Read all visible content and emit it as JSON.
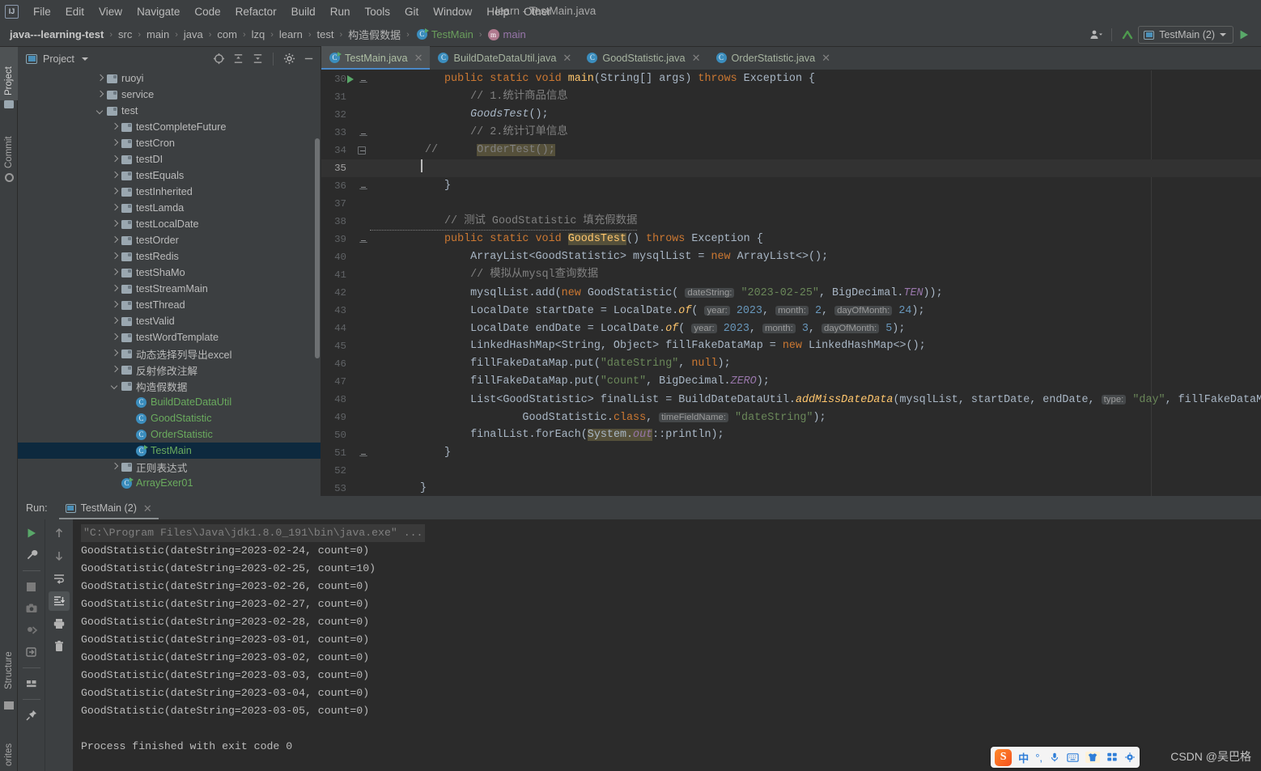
{
  "window": {
    "title": "learn - TestMain.java"
  },
  "menubar": {
    "logo": "ij-logo",
    "items": [
      "File",
      "Edit",
      "View",
      "Navigate",
      "Code",
      "Refactor",
      "Build",
      "Run",
      "Tools",
      "Git",
      "Window",
      "Help",
      "Other"
    ]
  },
  "breadcrumb": {
    "items": [
      {
        "label": "java---learning-test",
        "style": "bold"
      },
      {
        "label": "src",
        "style": "plain"
      },
      {
        "label": "main",
        "style": "plain"
      },
      {
        "label": "java",
        "style": "plain"
      },
      {
        "label": "com",
        "style": "plain"
      },
      {
        "label": "lzq",
        "style": "plain"
      },
      {
        "label": "learn",
        "style": "plain"
      },
      {
        "label": "test",
        "style": "plain"
      },
      {
        "label": "构造假数据",
        "style": "plain"
      },
      {
        "label": "TestMain",
        "style": "green"
      },
      {
        "label": "main",
        "style": "mauve"
      }
    ],
    "separator": "›"
  },
  "toolbar_right": {
    "user_icon": "user-avatar-icon",
    "updates_icon": "update-arrow-icon",
    "run_config": "TestMain (2)",
    "run_button_icon": "run-play-icon"
  },
  "left_strip": {
    "tabs": [
      {
        "label": "Project",
        "icon": "project-icon",
        "active": true
      },
      {
        "label": "Commit",
        "icon": "commit-icon",
        "active": false
      }
    ],
    "bottom_tabs": [
      {
        "label": "Structure",
        "icon": "structure-icon"
      },
      {
        "label": "orites",
        "icon": "favorites-icon"
      }
    ]
  },
  "project_panel": {
    "title": "Project",
    "title_icon": "project-window-icon",
    "dropdown_icon": "chevron-down-icon",
    "tools": [
      "locate-icon",
      "expand-all-icon",
      "collapse-all-icon",
      "gear-icon",
      "minimize-icon"
    ],
    "tree": [
      {
        "label": "ruoyi",
        "type": "folder",
        "indent": 1,
        "state": "collapsed"
      },
      {
        "label": "service",
        "type": "folder",
        "indent": 1,
        "state": "collapsed"
      },
      {
        "label": "test",
        "type": "folder",
        "indent": 1,
        "state": "expanded"
      },
      {
        "label": "testCompleteFuture",
        "type": "folder",
        "indent": 2,
        "state": "collapsed"
      },
      {
        "label": "testCron",
        "type": "folder",
        "indent": 2,
        "state": "collapsed"
      },
      {
        "label": "testDI",
        "type": "folder",
        "indent": 2,
        "state": "collapsed"
      },
      {
        "label": "testEquals",
        "type": "folder",
        "indent": 2,
        "state": "collapsed"
      },
      {
        "label": "testInherited",
        "type": "folder",
        "indent": 2,
        "state": "collapsed"
      },
      {
        "label": "testLamda",
        "type": "folder",
        "indent": 2,
        "state": "collapsed"
      },
      {
        "label": "testLocalDate",
        "type": "folder",
        "indent": 2,
        "state": "collapsed"
      },
      {
        "label": "testOrder",
        "type": "folder",
        "indent": 2,
        "state": "collapsed"
      },
      {
        "label": "testRedis",
        "type": "folder",
        "indent": 2,
        "state": "collapsed"
      },
      {
        "label": "testShaMo",
        "type": "folder",
        "indent": 2,
        "state": "collapsed"
      },
      {
        "label": "testStreamMain",
        "type": "folder",
        "indent": 2,
        "state": "collapsed"
      },
      {
        "label": "testThread",
        "type": "folder",
        "indent": 2,
        "state": "collapsed"
      },
      {
        "label": "testValid",
        "type": "folder",
        "indent": 2,
        "state": "collapsed"
      },
      {
        "label": "testWordTemplate",
        "type": "folder",
        "indent": 2,
        "state": "collapsed"
      },
      {
        "label": "动态选择列导出excel",
        "type": "folder",
        "indent": 2,
        "state": "collapsed"
      },
      {
        "label": "反射修改注解",
        "type": "folder",
        "indent": 2,
        "state": "collapsed"
      },
      {
        "label": "构造假数据",
        "type": "folder",
        "indent": 2,
        "state": "expanded"
      },
      {
        "label": "BuildDateDataUtil",
        "type": "class",
        "indent": 3,
        "state": "leaf"
      },
      {
        "label": "GoodStatistic",
        "type": "class",
        "indent": 3,
        "state": "leaf"
      },
      {
        "label": "OrderStatistic",
        "type": "class",
        "indent": 3,
        "state": "leaf"
      },
      {
        "label": "TestMain",
        "type": "class-runnable",
        "indent": 3,
        "state": "leaf",
        "selected": true
      },
      {
        "label": "正则表达式",
        "type": "folder",
        "indent": 2,
        "state": "collapsed"
      },
      {
        "label": "ArrayExer01",
        "type": "class-runnable",
        "indent": 2,
        "state": "leaf"
      }
    ]
  },
  "editor_tabs": [
    {
      "label": "TestMain.java",
      "icon": "java-class-runnable-icon",
      "active": true,
      "close": "✕"
    },
    {
      "label": "BuildDateDataUtil.java",
      "icon": "java-class-icon",
      "active": false,
      "close": "✕"
    },
    {
      "label": "GoodStatistic.java",
      "icon": "java-class-icon",
      "active": false,
      "close": "✕"
    },
    {
      "label": "OrderStatistic.java",
      "icon": "java-class-icon",
      "active": false,
      "close": "✕"
    }
  ],
  "editor": {
    "first_line": 30,
    "current_line": 35,
    "lines": [
      {
        "n": "30",
        "text": "public static void main(String[] args) throws Exception {"
      },
      {
        "n": "31",
        "text": "    // 1.统计商品信息"
      },
      {
        "n": "32",
        "text": "    GoodsTest();"
      },
      {
        "n": "33",
        "text": "    // 2.统计订单信息"
      },
      {
        "n": "34",
        "text": "//      OrderTest();"
      },
      {
        "n": "35",
        "text": ""
      },
      {
        "n": "36",
        "text": "}"
      },
      {
        "n": "37",
        "text": ""
      },
      {
        "n": "38",
        "text": "// 测试 GoodStatistic 填充假数据"
      },
      {
        "n": "39",
        "text": "public static void GoodsTest() throws Exception {"
      },
      {
        "n": "40",
        "text": "    ArrayList<GoodStatistic> mysqlList = new ArrayList<>();"
      },
      {
        "n": "41",
        "text": "    // 模拟从mysql查询数据"
      },
      {
        "n": "42",
        "text": "    mysqlList.add(new GoodStatistic( dateString: \"2023-02-25\", BigDecimal.TEN));"
      },
      {
        "n": "43",
        "text": "    LocalDate startDate = LocalDate.of( year: 2023, month: 2, dayOfMonth: 24);"
      },
      {
        "n": "44",
        "text": "    LocalDate endDate = LocalDate.of( year: 2023, month: 3, dayOfMonth: 5);"
      },
      {
        "n": "45",
        "text": "    LinkedHashMap<String, Object> fillFakeDataMap = new LinkedHashMap<>();"
      },
      {
        "n": "46",
        "text": "    fillFakeDataMap.put(\"dateString\", null);"
      },
      {
        "n": "47",
        "text": "    fillFakeDataMap.put(\"count\", BigDecimal.ZERO);"
      },
      {
        "n": "48",
        "text": "    List<GoodStatistic> finalList = BuildDateDataUtil.addMissDateData(mysqlList, startDate, endDate,  type: \"day\", fillFakeDataMap,"
      },
      {
        "n": "49",
        "text": "            GoodStatistic.class,  timeFieldName: \"dateString\");"
      },
      {
        "n": "50",
        "text": "    finalList.forEach(System.out::println);"
      },
      {
        "n": "51",
        "text": "}"
      },
      {
        "n": "52",
        "text": ""
      },
      {
        "n": "53",
        "text": "}"
      }
    ]
  },
  "run_panel": {
    "run_label": "Run:",
    "tab_label": "TestMain (2)",
    "tab_close": "✕",
    "tools_left": [
      "rerun-icon",
      "settings-wrench-icon",
      "stop-icon",
      "camera-icon",
      "thread-dump-icon",
      "export-icon",
      "layout-icon",
      "pin-icon"
    ],
    "tools_right": [
      "up-arrow-icon",
      "down-arrow-icon",
      "soft-wrap-icon",
      "scroll-to-end-icon",
      "print-icon",
      "trash-icon"
    ],
    "console": [
      {
        "text": "\"C:\\Program Files\\Java\\jdk1.8.0_191\\bin\\java.exe\" ...",
        "kind": "cmd"
      },
      {
        "text": "GoodStatistic(dateString=2023-02-24, count=0)",
        "kind": "out"
      },
      {
        "text": "GoodStatistic(dateString=2023-02-25, count=10)",
        "kind": "out"
      },
      {
        "text": "GoodStatistic(dateString=2023-02-26, count=0)",
        "kind": "out"
      },
      {
        "text": "GoodStatistic(dateString=2023-02-27, count=0)",
        "kind": "out"
      },
      {
        "text": "GoodStatistic(dateString=2023-02-28, count=0)",
        "kind": "out"
      },
      {
        "text": "GoodStatistic(dateString=2023-03-01, count=0)",
        "kind": "out"
      },
      {
        "text": "GoodStatistic(dateString=2023-03-02, count=0)",
        "kind": "out"
      },
      {
        "text": "GoodStatistic(dateString=2023-03-03, count=0)",
        "kind": "out"
      },
      {
        "text": "GoodStatistic(dateString=2023-03-04, count=0)",
        "kind": "out"
      },
      {
        "text": "GoodStatistic(dateString=2023-03-05, count=0)",
        "kind": "out"
      },
      {
        "text": "",
        "kind": "out"
      },
      {
        "text": "Process finished with exit code 0",
        "kind": "out"
      }
    ]
  },
  "ime_bar": {
    "logo": "sogou-logo",
    "items": [
      {
        "icon": "chinese-mode-icon",
        "glyph": "中"
      },
      {
        "icon": "punctuation-icon",
        "glyph": "°,"
      },
      {
        "icon": "microphone-icon",
        "glyph": "Ἲ4"
      },
      {
        "icon": "keyboard-icon",
        "glyph": "⌨"
      },
      {
        "icon": "skin-icon",
        "glyph": "T"
      },
      {
        "icon": "apps-grid-icon",
        "glyph": "░"
      },
      {
        "icon": "settings-bug-icon",
        "glyph": "⚙"
      }
    ]
  },
  "watermark": {
    "text": "CSDN @吴巴格"
  },
  "colors": {
    "accent_blue": "#4a88c7",
    "run_green": "#59a869",
    "keyword_orange": "#cc7832",
    "string_green": "#6a8759",
    "number_blue": "#6897bb",
    "comment_gray": "#808080",
    "field_purple": "#9876aa",
    "method_yellow": "#ffc66d",
    "editor_bg": "#2b2b2b",
    "panel_bg": "#3c3f41",
    "selection_bg": "#0d293e"
  }
}
